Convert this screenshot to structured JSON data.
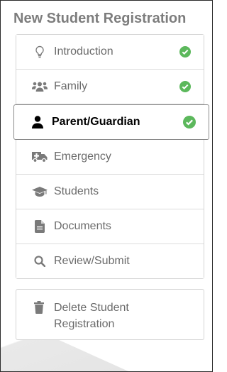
{
  "title": "New Student Registration",
  "steps": [
    {
      "label": "Introduction",
      "icon": "lightbulb-icon",
      "completed": true
    },
    {
      "label": "Family",
      "icon": "users-icon",
      "completed": true
    },
    {
      "label": "Parent/Guardian",
      "icon": "user-icon",
      "completed": true,
      "active": true
    },
    {
      "label": "Emergency",
      "icon": "ambulance-icon",
      "completed": false
    },
    {
      "label": "Students",
      "icon": "graduation-cap-icon",
      "completed": false
    },
    {
      "label": "Documents",
      "icon": "document-icon",
      "completed": false
    },
    {
      "label": "Review/Submit",
      "icon": "search-icon",
      "completed": false
    }
  ],
  "delete": {
    "label": "Delete Student Registration",
    "icon": "trash-icon"
  },
  "colors": {
    "check": "#5cb85c",
    "icon": "#7a7a7a",
    "title": "#7d7d7d"
  }
}
